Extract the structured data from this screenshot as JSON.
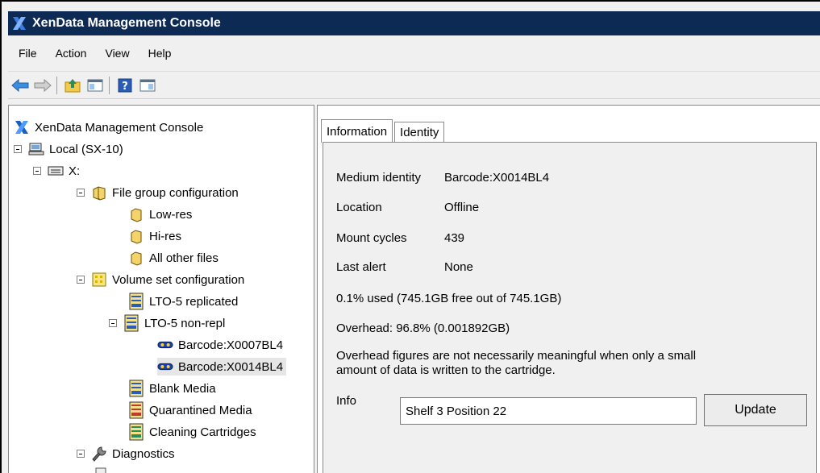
{
  "window": {
    "title": "XenData Management Console"
  },
  "menu": [
    "File",
    "Action",
    "View",
    "Help"
  ],
  "toolbar": [
    "back-arrow",
    "forward-arrow",
    "up-folder",
    "show-hide-tree",
    "help",
    "action-pane"
  ],
  "tree": {
    "root": "XenData Management Console",
    "local": "Local (SX-10)",
    "drive": "X:",
    "file_group_config": "File group configuration",
    "low_res": "Low-res",
    "hi_res": "Hi-res",
    "all_other_files": "All other files",
    "volume_set_config": "Volume set configuration",
    "lto5_replicated": "LTO-5 replicated",
    "lto5_nonrepl": "LTO-5 non-repl",
    "barcode_1": "Barcode:X0007BL4",
    "barcode_2": "Barcode:X0014BL4",
    "blank_media": "Blank Media",
    "quarantined_media": "Quarantined Media",
    "cleaning_cartridges": "Cleaning Cartridges",
    "diagnostics": "Diagnostics"
  },
  "tabs": [
    "Information",
    "Identity"
  ],
  "info": {
    "medium_identity_label": "Medium identity",
    "medium_identity_value": "Barcode:X0014BL4",
    "location_label": "Location",
    "location_value": "Offline",
    "mount_cycles_label": "Mount cycles",
    "mount_cycles_value": "439",
    "last_alert_label": "Last alert",
    "last_alert_value": "None",
    "used": "0.1% used (745.1GB free out of 745.1GB)",
    "overhead": "Overhead: 96.8% (0.001892GB)",
    "overhead_note_1": "Overhead figures are not necessarily meaningful when only a small",
    "overhead_note_2": "amount of data is written to the cartridge.",
    "info_label": "Info",
    "info_value": "Shelf 3 Position 22",
    "update_label": "Update"
  },
  "colors": {
    "titlebar": "#0d2a55",
    "accent": "#2a6fd6"
  }
}
